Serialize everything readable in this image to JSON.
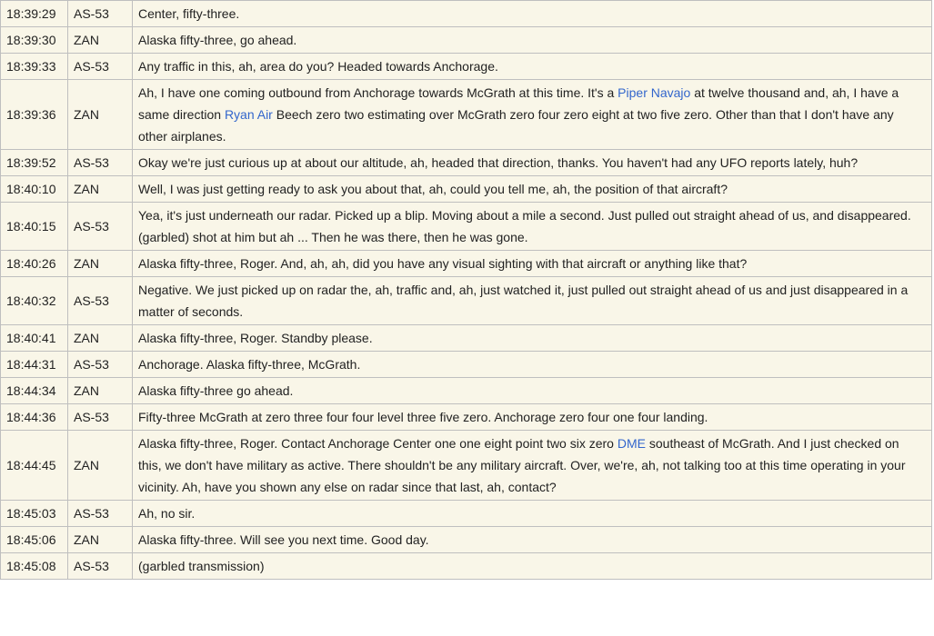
{
  "transcript": {
    "rows": [
      {
        "time": "18:39:29",
        "speaker": "AS-53",
        "parts": [
          {
            "t": "Center, fifty-three."
          }
        ]
      },
      {
        "time": "18:39:30",
        "speaker": "ZAN",
        "parts": [
          {
            "t": "Alaska fifty-three, go ahead."
          }
        ]
      },
      {
        "time": "18:39:33",
        "speaker": "AS-53",
        "parts": [
          {
            "t": "Any traffic in this, ah, area do you? Headed towards Anchorage."
          }
        ]
      },
      {
        "time": "18:39:36",
        "speaker": "ZAN",
        "parts": [
          {
            "t": "Ah, I have one coming outbound from Anchorage towards McGrath at this time. It's a "
          },
          {
            "t": "Piper Navajo",
            "link": true
          },
          {
            "t": " at twelve thousand and, ah, I have a same direction "
          },
          {
            "t": "Ryan Air",
            "link": true
          },
          {
            "t": " Beech zero two estimating over McGrath zero four zero eight at two five zero. Other than that I don't have any other airplanes."
          }
        ]
      },
      {
        "time": "18:39:52",
        "speaker": "AS-53",
        "parts": [
          {
            "t": "Okay we're just curious up at about our altitude, ah, headed that direction, thanks. You haven't had any UFO reports lately, huh?"
          }
        ]
      },
      {
        "time": "18:40:10",
        "speaker": "ZAN",
        "parts": [
          {
            "t": "Well, I was just getting ready to ask you about that, ah, could you tell me, ah, the position of that aircraft?"
          }
        ]
      },
      {
        "time": "18:40:15",
        "speaker": "AS-53",
        "parts": [
          {
            "t": "Yea, it's just underneath our radar. Picked up a blip. Moving about a mile a second. Just pulled out straight ahead of us, and disappeared. (garbled) shot at him but ah ... Then he was there, then he was gone."
          }
        ]
      },
      {
        "time": "18:40:26",
        "speaker": "ZAN",
        "parts": [
          {
            "t": "Alaska fifty-three, Roger. And, ah, ah, did you have any visual sighting with that aircraft or anything like that?"
          }
        ]
      },
      {
        "time": "18:40:32",
        "speaker": "AS-53",
        "parts": [
          {
            "t": "Negative. We just picked up on radar the, ah, traffic and, ah, just watched it, just pulled out straight ahead of us and just disappeared in a matter of seconds."
          }
        ]
      },
      {
        "time": "18:40:41",
        "speaker": "ZAN",
        "parts": [
          {
            "t": "Alaska fifty-three, Roger. Standby please."
          }
        ]
      },
      {
        "time": "18:44:31",
        "speaker": "AS-53",
        "parts": [
          {
            "t": "Anchorage. Alaska fifty-three, McGrath."
          }
        ]
      },
      {
        "time": "18:44:34",
        "speaker": "ZAN",
        "parts": [
          {
            "t": "Alaska fifty-three go ahead."
          }
        ]
      },
      {
        "time": "18:44:36",
        "speaker": "AS-53",
        "parts": [
          {
            "t": "Fifty-three McGrath at zero three four four level three five zero. Anchorage zero four one four landing."
          }
        ]
      },
      {
        "time": "18:44:45",
        "speaker": "ZAN",
        "parts": [
          {
            "t": "Alaska fifty-three, Roger. Contact Anchorage Center one one eight point two six zero "
          },
          {
            "t": "DME",
            "link": true
          },
          {
            "t": " southeast of McGrath. And I just checked on this, we don't have military as active. There shouldn't be any military aircraft. Over, we're, ah, not talking too at this time operating in your vicinity. Ah, have you shown any else on radar since that last, ah, contact?"
          }
        ]
      },
      {
        "time": "18:45:03",
        "speaker": "AS-53",
        "parts": [
          {
            "t": "Ah, no sir."
          }
        ]
      },
      {
        "time": "18:45:06",
        "speaker": "ZAN",
        "parts": [
          {
            "t": "Alaska fifty-three. Will see you next time. Good day."
          }
        ]
      },
      {
        "time": "18:45:08",
        "speaker": "AS-53",
        "parts": [
          {
            "t": "(garbled transmission)"
          }
        ]
      }
    ]
  }
}
